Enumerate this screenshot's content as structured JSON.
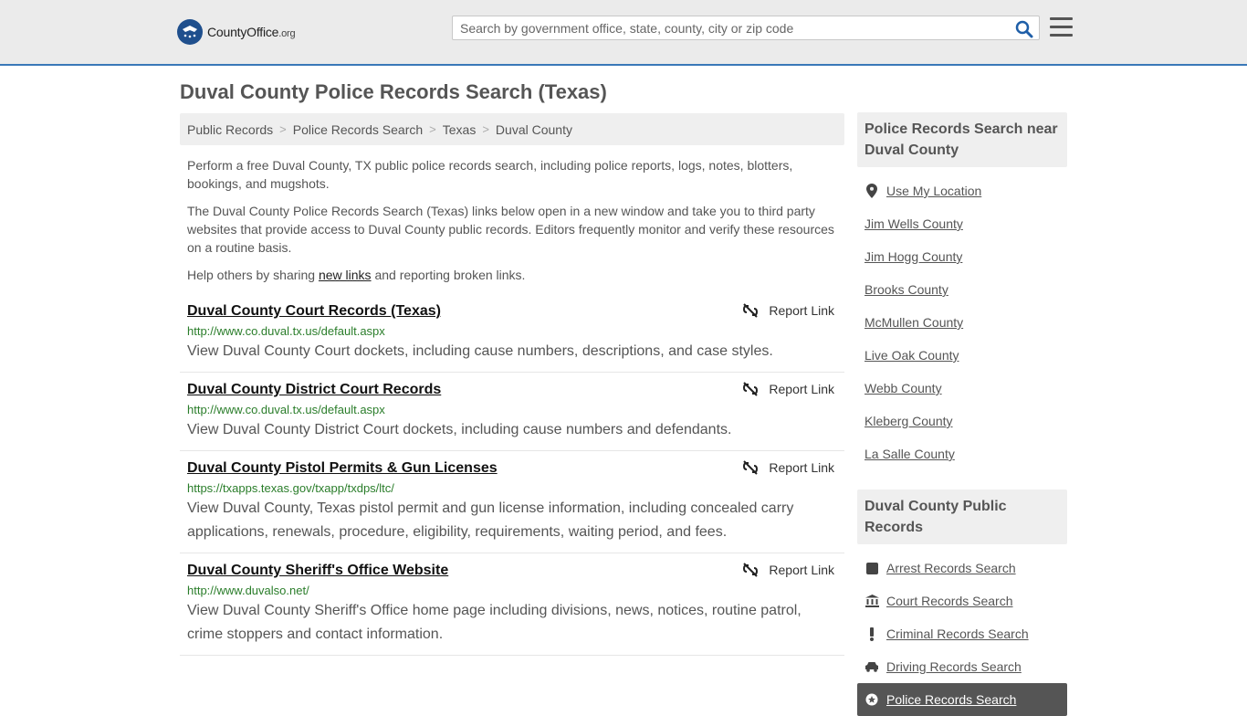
{
  "header": {
    "logo_main": "CountyOffice",
    "logo_suffix": ".org",
    "search_placeholder": "Search by government office, state, county, city or zip code"
  },
  "page": {
    "title": "Duval County Police Records Search (Texas)"
  },
  "breadcrumb": [
    "Public Records",
    "Police Records Search",
    "Texas",
    "Duval County"
  ],
  "intro": {
    "p1": "Perform a free Duval County, TX public police records search, including police reports, logs, notes, blotters, bookings, and mugshots.",
    "p2": "The Duval County Police Records Search (Texas) links below open in a new window and take you to third party websites that provide access to Duval County public records. Editors frequently monitor and verify these resources on a routine basis.",
    "p3_before": "Help others by sharing ",
    "p3_link": "new links",
    "p3_after": " and reporting broken links."
  },
  "report_label": "Report Link",
  "results": [
    {
      "title": "Duval County Court Records (Texas)",
      "url": "http://www.co.duval.tx.us/default.aspx",
      "desc": "View Duval County Court dockets, including cause numbers, descriptions, and case styles."
    },
    {
      "title": "Duval County District Court Records",
      "url": "http://www.co.duval.tx.us/default.aspx",
      "desc": "View Duval County District Court dockets, including cause numbers and defendants."
    },
    {
      "title": "Duval County Pistol Permits & Gun Licenses",
      "url": "https://txapps.texas.gov/txapp/txdps/ltc/",
      "desc": "View Duval County, Texas pistol permit and gun license information, including concealed carry applications, renewals, procedure, eligibility, requirements, waiting period, and fees."
    },
    {
      "title": "Duval County Sheriff's Office Website",
      "url": "http://www.duvalso.net/",
      "desc": "View Duval County Sheriff's Office home page including divisions, news, notices, routine patrol, crime stoppers and contact information."
    }
  ],
  "sidebar": {
    "nearby_title": "Police Records Search near Duval County",
    "use_location": "Use My Location",
    "nearby": [
      "Jim Wells County",
      "Jim Hogg County",
      "Brooks County",
      "McMullen County",
      "Live Oak County",
      "Webb County",
      "Kleberg County",
      "La Salle County"
    ],
    "public_title": "Duval County Public Records",
    "public_links": [
      {
        "label": "Arrest Records Search",
        "icon": "arrest-square-icon"
      },
      {
        "label": "Court Records Search",
        "icon": "courthouse-icon"
      },
      {
        "label": "Criminal Records Search",
        "icon": "exclamation-icon"
      },
      {
        "label": "Driving Records Search",
        "icon": "car-icon"
      },
      {
        "label": "Police Records Search",
        "icon": "police-badge-icon"
      }
    ]
  }
}
